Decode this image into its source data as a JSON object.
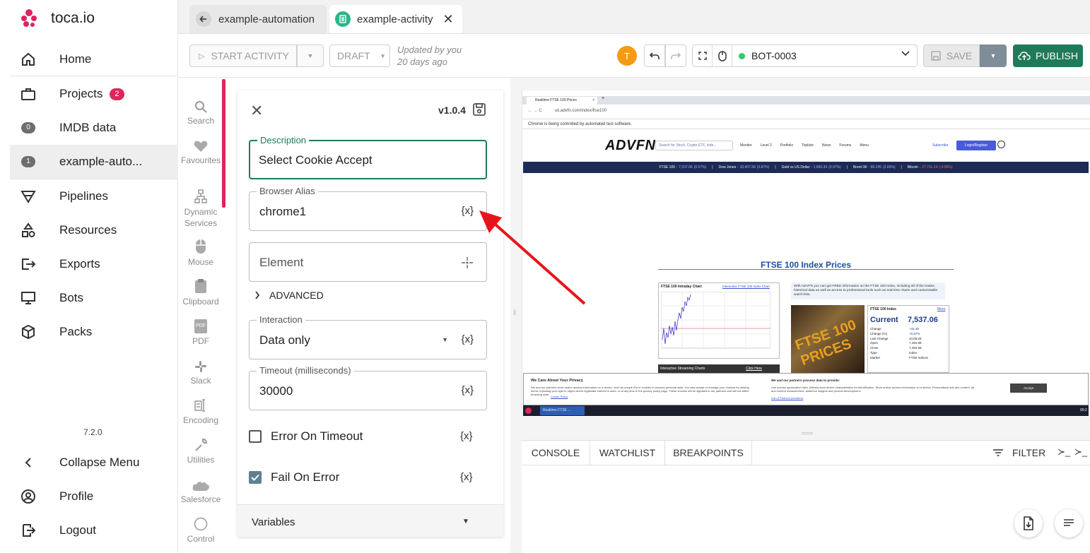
{
  "brand": {
    "name": "toca.io"
  },
  "sidebar": {
    "items": [
      {
        "label": "Home"
      },
      {
        "label": "Projects",
        "badge": "2"
      },
      {
        "label": "IMDB data",
        "count": "0"
      },
      {
        "label": "example-auto...",
        "count": "1"
      },
      {
        "label": "Pipelines"
      },
      {
        "label": "Resources"
      },
      {
        "label": "Exports"
      },
      {
        "label": "Bots"
      },
      {
        "label": "Packs"
      }
    ],
    "version": "7.2.0",
    "bottom": [
      {
        "label": "Collapse Menu"
      },
      {
        "label": "Profile"
      },
      {
        "label": "Logout"
      }
    ]
  },
  "tabs": [
    {
      "label": "example-automation"
    },
    {
      "label": "example-activity"
    }
  ],
  "toolbar": {
    "start_label": "START ACTIVITY",
    "draft_label": "DRAFT",
    "updated_line1": "Updated by you",
    "updated_line2": "20 days ago",
    "avatar_initial": "T",
    "bot_name": "BOT-0003",
    "save_label": "SAVE",
    "publish_label": "PUBLISH"
  },
  "tools": [
    {
      "label": "Search"
    },
    {
      "label": "Favourites"
    },
    {
      "label": "Dynamic Services"
    },
    {
      "label": "Mouse"
    },
    {
      "label": "Clipboard"
    },
    {
      "label": "PDF"
    },
    {
      "label": "Slack"
    },
    {
      "label": "Encoding"
    },
    {
      "label": "Utilities"
    },
    {
      "label": "Salesforce"
    },
    {
      "label": "Control"
    }
  ],
  "form": {
    "version": "v1.0.4",
    "description_label": "Description",
    "description_value": "Select Cookie Accept",
    "alias_label": "Browser Alias",
    "alias_value": "chrome1",
    "element_placeholder": "Element",
    "advanced_label": "ADVANCED",
    "interaction_label": "Interaction",
    "interaction_value": "Data only",
    "timeout_label": "Timeout (milliseconds)",
    "timeout_value": "30000",
    "error_on_timeout_label": "Error On Timeout",
    "fail_on_error_label": "Fail On Error",
    "variables_label": "Variables",
    "var_token": "{x}"
  },
  "browser": {
    "tab_title": "Realtime FTSE 100 Prices",
    "url": "uk.advfn.com/index/ftse100",
    "automation_notice": "Chrome is being controlled by automated test software.",
    "logo": "ADVFN",
    "search_placeholder": "Search for Stock, Crypto ETF, Inde...",
    "nav": [
      "Monitor",
      "Level 2",
      "Portfolio",
      "Toplists",
      "News",
      "Forums",
      "Menu"
    ],
    "subscribe": "Subscribe",
    "login": "Login/Register",
    "ticker": [
      {
        "name": "FTSE 100",
        "value": "7,537.06",
        "change": "(0.57%)",
        "dir": "up"
      },
      {
        "name": "Dow Jones",
        "value": "33,407.58",
        "change": "(0.87%)",
        "dir": "up"
      },
      {
        "name": "Gold vs US Dollar",
        "value": "1,850.39",
        "change": "(0.97%)",
        "dir": "up"
      },
      {
        "name": "Brent Oil",
        "value": "86.245",
        "change": "(2.65%)",
        "dir": "up"
      },
      {
        "name": "Bitcoin",
        "value": "27,791.24",
        "change": "(-0.56%)",
        "dir": "down"
      }
    ],
    "heading": "FTSE 100 Index Prices",
    "chart_title": "FTSE 100 Intraday Chart",
    "chart_link": "Interactive FTSE 100 Index Chart",
    "blurb": "With ADVFN you can get FREE information on the FTSE 100 Index, including all of the trades, historical data as well as access to professional tools such as real-time charts and customisable watch-lists.",
    "index_box_title": "FTSE 100 Index",
    "index_box_more": "More",
    "current_label": "Current",
    "current_value": "7,537.06",
    "stats": [
      {
        "k": "Change",
        "v": "+42.48"
      },
      {
        "k": "Change (%)",
        "v": "+0.57%"
      },
      {
        "k": "Last Change",
        "v": "10:06:29"
      },
      {
        "k": "Open",
        "v": "7,494.58"
      },
      {
        "k": "Close",
        "v": "7,494.58"
      },
      {
        "k": "Type",
        "v": "Index"
      },
      {
        "k": "Market",
        "v": "FTSE Indices"
      }
    ],
    "streaming": "Interactive Streaming Charts",
    "click_here": "Click Here",
    "privacy_title": "We Care About Your Privacy",
    "privacy_text": "We and our partners store and/or access information on a device, such as unique IDs in cookies to process personal data. You may accept or manage your choices by clicking below, including your right to object where legitimate interest is used, or at any time in the privacy policy page. These choices will be signaled to our partners and will not affect browsing data.",
    "privacy_link": "Cookie Policy",
    "partners_title": "We and our partners process data to provide:",
    "partners_text": "Use precise geolocation data. Actively scan device characteristics for identification. Store and/or access information on a device. Personalised ads and content, ad and content measurement, audience insights and product development.",
    "partners_link": "List of Partners (vendors)",
    "accept": "Accept",
    "taskbar_item": "Realtime FTSE ...",
    "clock": "09:2"
  },
  "console": {
    "tabs": [
      "CONSOLE",
      "WATCHLIST",
      "BREAKPOINTS"
    ],
    "filter_label": "FILTER"
  },
  "colors": {
    "accent": "#e0245e",
    "brand_green": "#1f7a5a",
    "publish": "#1f7a5a",
    "arrow": "#e8141b"
  }
}
